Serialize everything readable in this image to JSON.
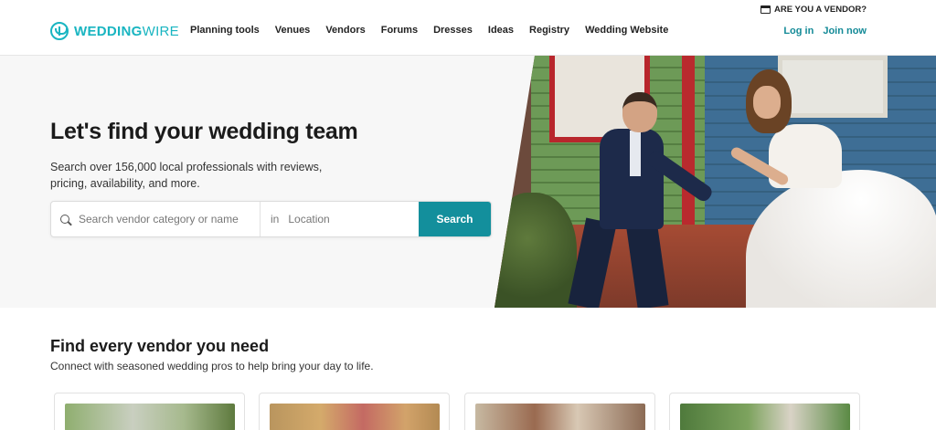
{
  "header": {
    "logo_text_bold": "WEDDING",
    "logo_text_light": "WIRE",
    "nav": [
      "Planning tools",
      "Venues",
      "Vendors",
      "Forums",
      "Dresses",
      "Ideas",
      "Registry",
      "Wedding Website"
    ],
    "vendor_link": "ARE YOU A VENDOR?",
    "login": "Log in",
    "join": "Join now"
  },
  "hero": {
    "title": "Let's find your wedding team",
    "subtitle": "Search over 156,000 local professionals with reviews, pricing, availability, and more.",
    "search": {
      "category_placeholder": "Search vendor category or name",
      "in_label": "in",
      "location_placeholder": "Location",
      "button": "Search"
    }
  },
  "vendors": {
    "title": "Find every vendor you need",
    "subtitle": "Connect with seasoned wedding pros to help bring your day to life."
  },
  "colors": {
    "brand": "#19b5c1",
    "button": "#138f9c",
    "link": "#138a97"
  }
}
